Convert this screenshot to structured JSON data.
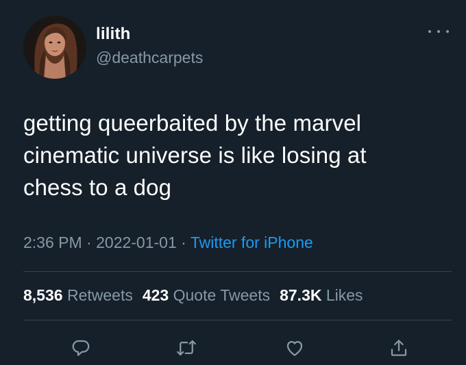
{
  "user": {
    "display_name": "lilith",
    "handle": "@deathcarpets"
  },
  "tweet": {
    "lines": [
      "getting queerbaited by the marvel",
      "cinematic universe is like losing at",
      "chess to a dog"
    ],
    "time": "2:36 PM",
    "date": "2022-01-01",
    "separator": "·",
    "source": "Twitter for iPhone"
  },
  "stats": {
    "retweets_count": "8,536",
    "retweets_label": "Retweets",
    "quote_count": "423",
    "quote_label": "Quote Tweets",
    "likes_count": "87.3K",
    "likes_label": "Likes"
  },
  "icons": {
    "more": "more-horizontal-icon",
    "reply": "reply-icon",
    "retweet": "retweet-icon",
    "like": "heart-icon",
    "share": "share-icon"
  },
  "colors": {
    "background": "#15202b",
    "primary_text": "#ffffff",
    "secondary_text": "#8899a6",
    "accent": "#1d9bf0",
    "divider": "#38444d"
  }
}
